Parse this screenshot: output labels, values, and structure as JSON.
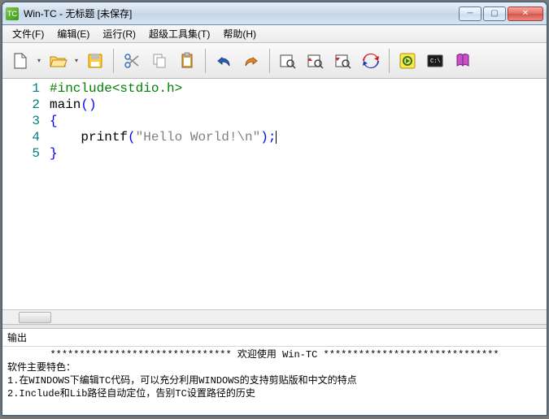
{
  "title": "Win-TC - 无标题 [未保存]",
  "menu": [
    "文件(F)",
    "编辑(E)",
    "运行(R)",
    "超级工具集(T)",
    "帮助(H)"
  ],
  "gutter": [
    "1",
    "2",
    "3",
    "4",
    "5"
  ],
  "code": {
    "l1_pp": "#include",
    "l1_hdr": "<stdio.h>",
    "l2_fn": "main",
    "l2_br": "()",
    "l3": "{",
    "l4_indent": "    ",
    "l4_fn": "printf",
    "l4_op": "(",
    "l4_str": "\"Hello World!\\n\"",
    "l4_cl": ");",
    "l5": "}"
  },
  "output": {
    "label": "输出",
    "banner": "******************************* 欢迎使用 Win-TC ******************************",
    "feat_title": "软件主要特色：",
    "feat1": "1.在WINDOWS下编辑TC代码，可以充分利用WINDOWS的支持剪贴版和中文的特点",
    "feat2": "2.Include和Lib路径自动定位，告别TC设置路径的历史"
  }
}
